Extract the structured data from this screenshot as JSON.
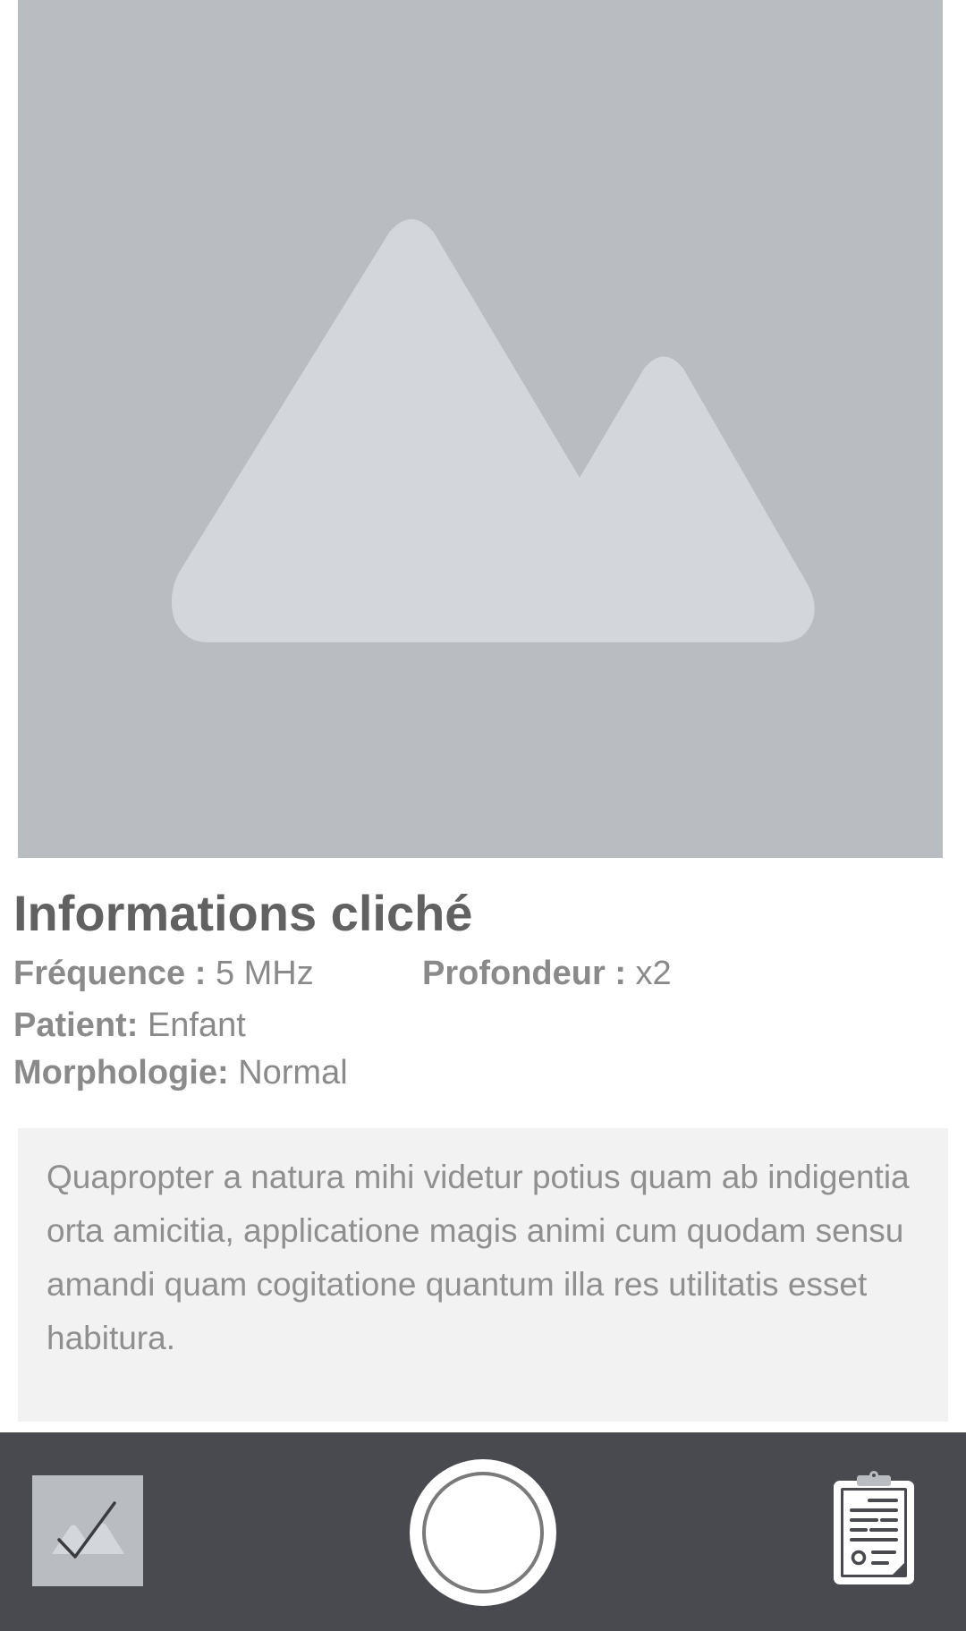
{
  "image_placeholder": {
    "icon": "image-placeholder-icon"
  },
  "info": {
    "title": "Informations cliché",
    "frequence": {
      "label": "Fréquence :",
      "value": "5 MHz"
    },
    "profondeur": {
      "label": "Profondeur :",
      "value": "x2"
    },
    "patient": {
      "label": "Patient:",
      "value": "Enfant"
    },
    "morphologie": {
      "label": "Morphologie:",
      "value": "Normal"
    }
  },
  "description": "Quapropter a natura mihi videtur potius quam ab indigentia orta amicitia, applicatione magis animi cum quodam sensu amandi quam cogitatione quantum illa res utilitatis esset habitura.",
  "bottom_bar": {
    "gallery_icon": "gallery-check-icon",
    "capture_icon": "shutter-icon",
    "report_icon": "clipboard-report-icon"
  },
  "colors": {
    "placeholder_bg": "#b9bcc0",
    "placeholder_fg": "#d3d6da",
    "bar_bg": "#484a4f",
    "desc_bg": "#f2f2f2",
    "title_text": "#616161"
  }
}
